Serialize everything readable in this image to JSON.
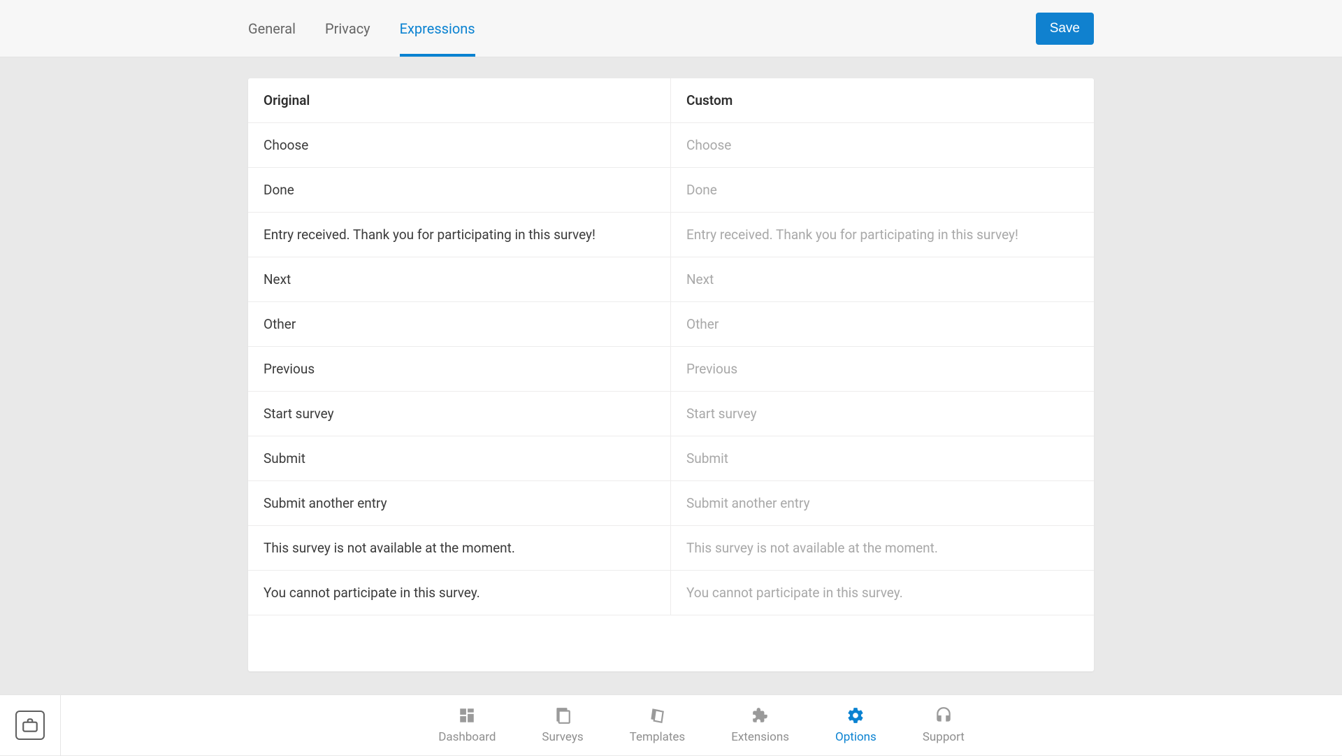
{
  "tabs": {
    "general": "General",
    "privacy": "Privacy",
    "expressions": "Expressions"
  },
  "save_label": "Save",
  "table": {
    "header_original": "Original",
    "header_custom": "Custom",
    "rows": [
      {
        "original": "Choose",
        "placeholder": "Choose"
      },
      {
        "original": "Done",
        "placeholder": "Done"
      },
      {
        "original": "Entry received. Thank you for participating in this survey!",
        "placeholder": "Entry received. Thank you for participating in this survey!"
      },
      {
        "original": "Next",
        "placeholder": "Next"
      },
      {
        "original": "Other",
        "placeholder": "Other"
      },
      {
        "original": "Previous",
        "placeholder": "Previous"
      },
      {
        "original": "Start survey",
        "placeholder": "Start survey"
      },
      {
        "original": "Submit",
        "placeholder": "Submit"
      },
      {
        "original": "Submit another entry",
        "placeholder": "Submit another entry"
      },
      {
        "original": "This survey is not available at the moment.",
        "placeholder": "This survey is not available at the moment."
      },
      {
        "original": "You cannot participate in this survey.",
        "placeholder": "You cannot participate in this survey."
      }
    ]
  },
  "bottomnav": {
    "dashboard": "Dashboard",
    "surveys": "Surveys",
    "templates": "Templates",
    "extensions": "Extensions",
    "options": "Options",
    "support": "Support"
  }
}
